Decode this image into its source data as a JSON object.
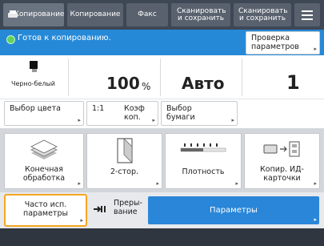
{
  "tabs": [
    {
      "label": "Копирование"
    },
    {
      "label": "Копирование"
    },
    {
      "label": "Факс"
    },
    {
      "label": "Сканировать и сохранить"
    },
    {
      "label": "Сканировать и сохранить"
    }
  ],
  "status": {
    "message": "Готов к копированию.",
    "check_button": "Проверка параметров"
  },
  "info": {
    "color_mode": "Черно-белый",
    "zoom_value": "100",
    "zoom_unit": "%",
    "paper": "Авто",
    "copies": "1"
  },
  "row2": {
    "color_select": "Выбор цвета",
    "ratio": "1:1",
    "ratio_label": "Коэф коп.",
    "paper_select": "Выбор бумаги"
  },
  "features": {
    "finishing": "Конечная обработка",
    "duplex": "2-стор.",
    "density": "Плотность",
    "id_card": "Копир. ИД-карточки"
  },
  "bottom": {
    "favorites": "Часто исп. параметры",
    "interrupt": "Преры-вание",
    "options": "Параметры"
  },
  "colors": {
    "status_bar": "#2689d8",
    "top_bar": "#3d4756",
    "favorites_border": "#f5a623",
    "options_button": "#2a86d8"
  }
}
